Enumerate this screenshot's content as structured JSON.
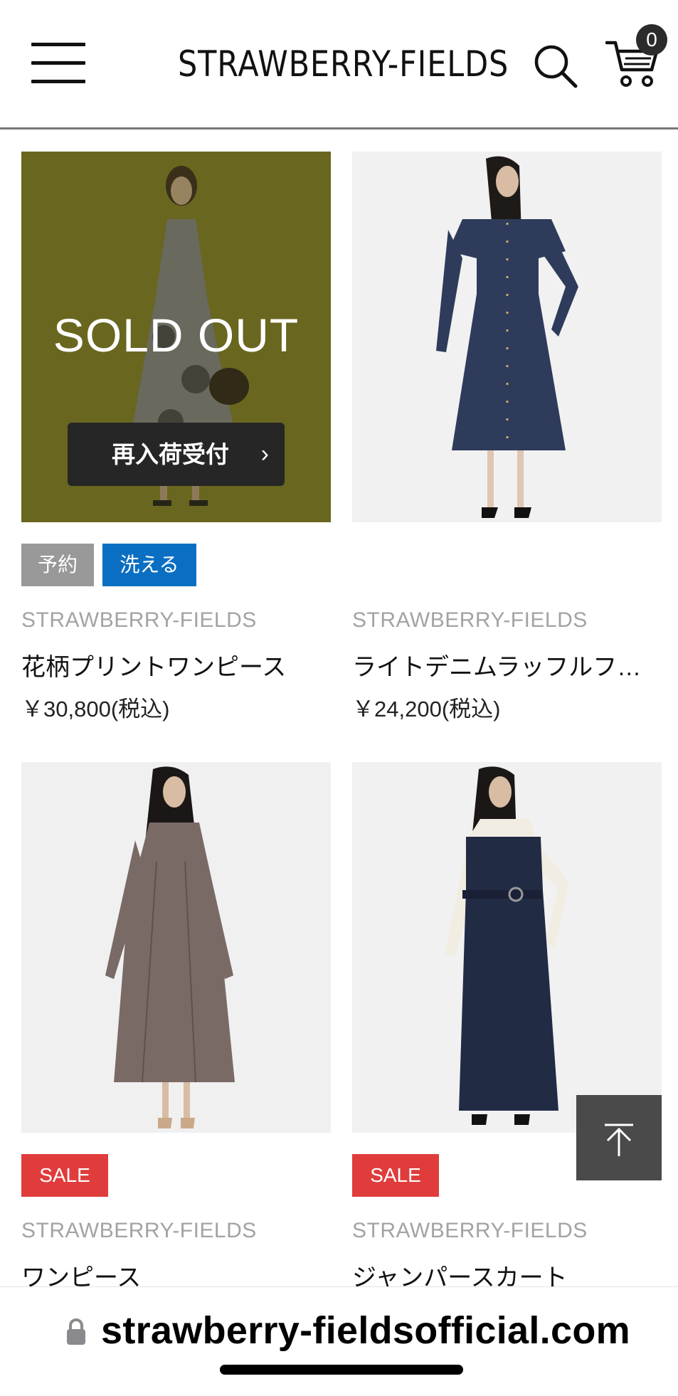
{
  "header": {
    "brand": "STRAWBERRY-FIELDS",
    "cart_count": "0",
    "icons": [
      "menu-icon",
      "search-icon",
      "cart-icon"
    ]
  },
  "products": [
    {
      "image": "model-floral-dress",
      "sold_out_label": "SOLD OUT",
      "restock_label": "再入荷受付",
      "badges": [
        {
          "label": "予約",
          "color": "#999999"
        },
        {
          "label": "洗える",
          "color": "#0a6fc2"
        }
      ],
      "brand": "STRAWBERRY-FIELDS",
      "name": "花柄プリントワンピース",
      "price": "￥30,800(税込)"
    },
    {
      "image": "model-denim-dress",
      "badges": [],
      "brand": "STRAWBERRY-FIELDS",
      "name": "ライトデニムラッフルフ…",
      "price": "￥24,200(税込)"
    },
    {
      "image": "model-brown-dress",
      "badges": [
        {
          "label": "SALE",
          "color": "#e03c3c"
        }
      ],
      "brand": "STRAWBERRY-FIELDS",
      "name": "ワンピース"
    },
    {
      "image": "model-jumper-skirt",
      "badges": [
        {
          "label": "SALE",
          "color": "#e03c3c"
        }
      ],
      "brand": "STRAWBERRY-FIELDS",
      "name": "ジャンパースカート"
    }
  ],
  "browser": {
    "url": "strawberry-fieldsofficial.com",
    "icons": [
      "lock-icon",
      "page-top-arrow-icon"
    ]
  }
}
